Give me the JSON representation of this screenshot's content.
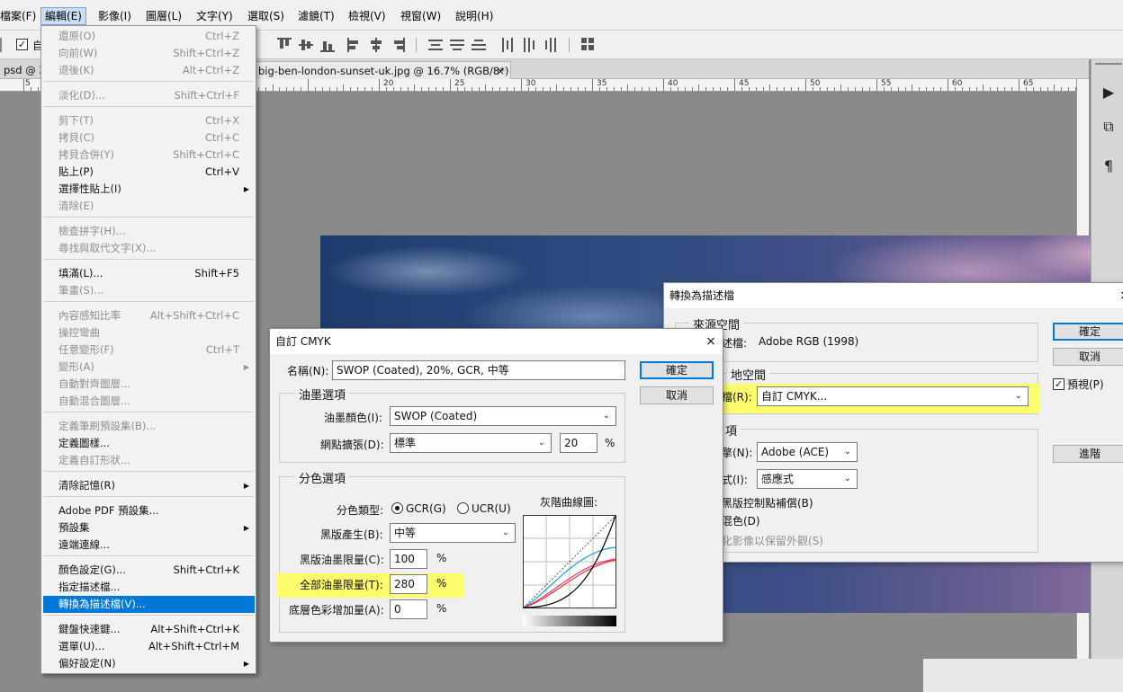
{
  "menubar": {
    "items": [
      "檔案(F)",
      "編輯(E)",
      "影像(I)",
      "圖層(L)",
      "文字(Y)",
      "選取(S)",
      "濾鏡(T)",
      "檢視(V)",
      "視窗(W)",
      "說明(H)"
    ]
  },
  "optionsbar": {
    "auto_label": "自"
  },
  "tabs": {
    "left_partial": "psd @ 2",
    "current": "big-ben-london-sunset-uk.jpg @ 16.7% (RGB/8*)",
    "close": "×"
  },
  "ruler": {
    "labels": [
      "5",
      "20",
      "25",
      "30",
      "35",
      "40",
      "45",
      "50",
      "55",
      "60",
      "65"
    ]
  },
  "edit_menu": {
    "items": [
      {
        "label": "還原(O)",
        "shortcut": "Ctrl+Z",
        "disabled": true
      },
      {
        "label": "向前(W)",
        "shortcut": "Shift+Ctrl+Z",
        "disabled": true
      },
      {
        "label": "退後(K)",
        "shortcut": "Alt+Ctrl+Z",
        "disabled": true
      },
      {
        "label": "淡化(D)...",
        "shortcut": "Shift+Ctrl+F",
        "disabled": true
      },
      {
        "label": "剪下(T)",
        "shortcut": "Ctrl+X",
        "disabled": true
      },
      {
        "label": "拷貝(C)",
        "shortcut": "Ctrl+C",
        "disabled": true
      },
      {
        "label": "拷貝合併(Y)",
        "shortcut": "Shift+Ctrl+C",
        "disabled": true
      },
      {
        "label": "貼上(P)",
        "shortcut": "Ctrl+V",
        "disabled": false
      },
      {
        "label": "選擇性貼上(I)",
        "shortcut": "",
        "disabled": false,
        "submenu": true
      },
      {
        "label": "清除(E)",
        "shortcut": "",
        "disabled": true
      },
      {
        "label": "檢查拼字(H)...",
        "shortcut": "",
        "disabled": true
      },
      {
        "label": "尋找與取代文字(X)...",
        "shortcut": "",
        "disabled": true
      },
      {
        "label": "填滿(L)...",
        "shortcut": "Shift+F5",
        "disabled": false
      },
      {
        "label": "筆畫(S)...",
        "shortcut": "",
        "disabled": true
      },
      {
        "label": "內容感知比率",
        "shortcut": "Alt+Shift+Ctrl+C",
        "disabled": true
      },
      {
        "label": "操控彎曲",
        "shortcut": "",
        "disabled": true
      },
      {
        "label": "任意變形(F)",
        "shortcut": "Ctrl+T",
        "disabled": true
      },
      {
        "label": "變形(A)",
        "shortcut": "",
        "disabled": true,
        "submenu": true
      },
      {
        "label": "自動對齊圖層...",
        "shortcut": "",
        "disabled": true
      },
      {
        "label": "自動混合圖層...",
        "shortcut": "",
        "disabled": true
      },
      {
        "label": "定義筆刷預設集(B)...",
        "shortcut": "",
        "disabled": true
      },
      {
        "label": "定義圖樣...",
        "shortcut": "",
        "disabled": false
      },
      {
        "label": "定義自訂形狀...",
        "shortcut": "",
        "disabled": true
      },
      {
        "label": "清除記憶(R)",
        "shortcut": "",
        "disabled": false,
        "submenu": true
      },
      {
        "label": "Adobe PDF 預設集...",
        "shortcut": "",
        "disabled": false
      },
      {
        "label": "預設集",
        "shortcut": "",
        "disabled": false,
        "submenu": true
      },
      {
        "label": "遠端連線...",
        "shortcut": "",
        "disabled": false
      },
      {
        "label": "顏色設定(G)...",
        "shortcut": "Shift+Ctrl+K",
        "disabled": false
      },
      {
        "label": "指定描述檔...",
        "shortcut": "",
        "disabled": false
      },
      {
        "label": "轉換為描述檔(V)...",
        "shortcut": "",
        "disabled": false,
        "highlighted": true
      },
      {
        "label": "鍵盤快速鍵...",
        "shortcut": "Alt+Shift+Ctrl+K",
        "disabled": false
      },
      {
        "label": "選單(U)...",
        "shortcut": "Alt+Shift+Ctrl+M",
        "disabled": false
      },
      {
        "label": "偏好設定(N)",
        "shortcut": "",
        "disabled": false,
        "submenu": true
      }
    ]
  },
  "convert_dialog": {
    "title": "轉換為描述檔",
    "close": "×",
    "source_group": "來源空間",
    "source_profile_label": "描述檔:",
    "source_profile_value": "Adobe RGB (1998)",
    "dest_group": "目的地空間",
    "dest_group_partial": "地空間",
    "dest_profile_label_partial": "檔(R):",
    "dest_profile_value": "自訂 CMYK...",
    "conv_group_partial": "項",
    "engine_label_partial": "擎(N):",
    "engine_value": "Adobe (ACE)",
    "intent_label_partial": "式(I):",
    "intent_value": "感應式",
    "bpc_partial": "黑版控制點補償(B)",
    "dither_partial": "混色(D)",
    "flatten_partial": "化影像以保留外觀(S)",
    "ok": "確定",
    "cancel": "取消",
    "preview": "預視(P)",
    "advanced": "進階"
  },
  "cmyk_dialog": {
    "title": "自訂 CMYK",
    "close": "×",
    "name_label": "名稱(N):",
    "name_value": "SWOP (Coated), 20%, GCR, 中等",
    "ok": "確定",
    "cancel": "取消",
    "ink_group": "油墨選項",
    "ink_colors_label": "油墨顏色(I):",
    "ink_colors_value": "SWOP (Coated)",
    "dot_gain_label": "網點擴張(D):",
    "dot_gain_value": "標準",
    "dot_gain_percent": "20",
    "percent": "%",
    "sep_group": "分色選項",
    "sep_type_label": "分色類型:",
    "gcr": "GCR(G)",
    "ucr": "UCR(U)",
    "gray_ramp": "灰階曲線圖:",
    "black_gen_label": "黑版產生(B):",
    "black_gen_value": "中等",
    "black_limit_label": "黑版油墨限量(C):",
    "black_limit_value": "100",
    "total_limit_label": "全部油墨限量(T):",
    "total_limit_value": "280",
    "ucr_amount_label": "底層色彩增加量(A):",
    "ucr_amount_value": "0"
  },
  "colors": {
    "highlight_yellow": "#fbfb6c",
    "menu_highlight": "#0078d7",
    "default_button_border": "#0078d7",
    "curve_cyan": "#1aa0e0",
    "curve_magenta": "#e0338a",
    "curve_yellow": "#e6c200",
    "curve_black": "#000000",
    "curve_red": "#e83a1e"
  }
}
